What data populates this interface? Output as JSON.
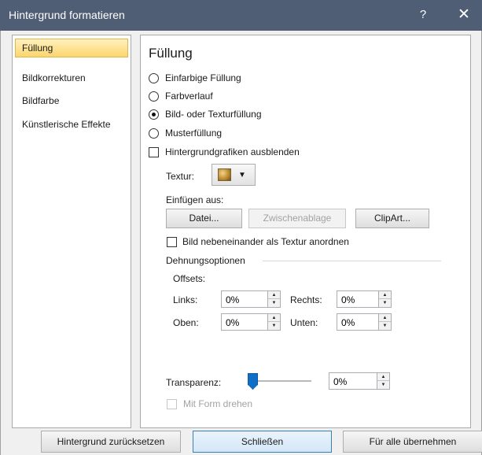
{
  "window": {
    "title": "Hintergrund formatieren",
    "help": "?",
    "close": "✕"
  },
  "sidebar": {
    "items": [
      {
        "label": "Füllung",
        "selected": true
      },
      {
        "label": "Bildkorrekturen",
        "selected": false
      },
      {
        "label": "Bildfarbe",
        "selected": false
      },
      {
        "label": "Künstlerische Effekte",
        "selected": false
      }
    ]
  },
  "panel": {
    "heading": "Füllung",
    "fill_options": [
      {
        "label": "Einfarbige Füllung",
        "selected": false
      },
      {
        "label": "Farbverlauf",
        "selected": false
      },
      {
        "label": "Bild- oder Texturfüllung",
        "selected": true
      },
      {
        "label": "Musterfüllung",
        "selected": false
      }
    ],
    "hide_background_graphics": {
      "label": "Hintergrundgrafiken ausblenden",
      "checked": false
    },
    "texture": {
      "label": "Textur:",
      "icon": "texture-swatch-icon"
    },
    "insert_from": {
      "label": "Einfügen aus:",
      "file_button": "Datei...",
      "clipboard_button": "Zwischenablage",
      "clipart_button": "ClipArt..."
    },
    "tile": {
      "label": "Bild nebeneinander als Textur anordnen",
      "checked": false
    },
    "stretch": {
      "label": "Dehnungsoptionen",
      "offsets_label": "Offsets:",
      "left_label": "Links:",
      "left_value": "0%",
      "right_label": "Rechts:",
      "right_value": "0%",
      "top_label": "Oben:",
      "top_value": "0%",
      "bottom_label": "Unten:",
      "bottom_value": "0%"
    },
    "transparency": {
      "label": "Transparenz:",
      "value": "0%",
      "level": 0
    },
    "rotate_with_shape": {
      "label": "Mit Form drehen",
      "checked": false,
      "disabled": true
    }
  },
  "footer": {
    "reset_button": "Hintergrund zurücksetzen",
    "close_button": "Schließen",
    "apply_all_button": "Für alle übernehmen"
  },
  "colors": {
    "titlebar": "#4f5d75",
    "selected_nav": "#fbd66d",
    "slider": "#0f6fc6"
  }
}
